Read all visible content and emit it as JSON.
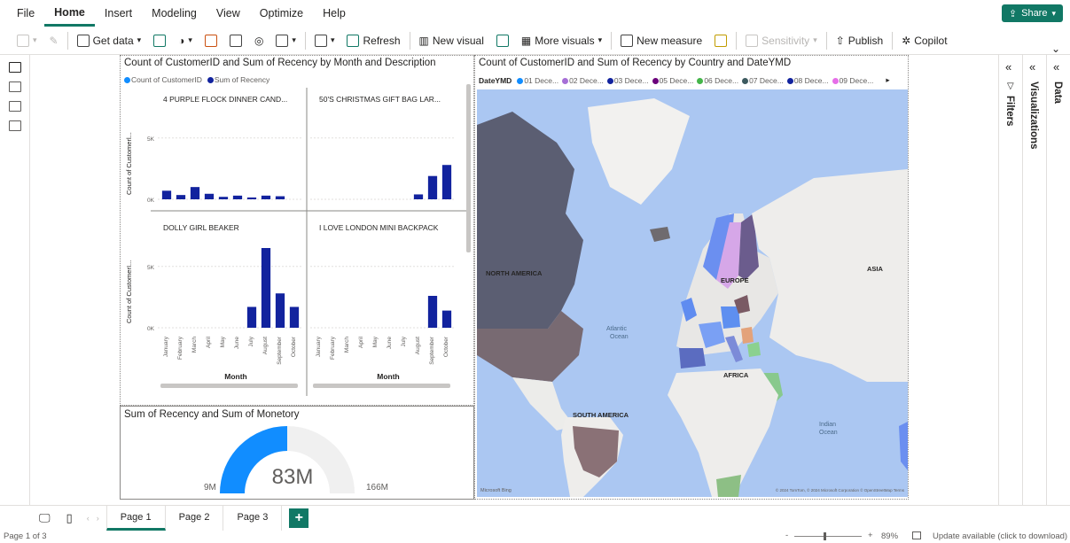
{
  "menu": {
    "items": [
      "File",
      "Home",
      "Insert",
      "Modeling",
      "View",
      "Optimize",
      "Help"
    ],
    "active": "Home",
    "share_label": "Share"
  },
  "ribbon": {
    "get_data": "Get data",
    "refresh": "Refresh",
    "new_visual": "New visual",
    "more_visuals": "More visuals",
    "new_measure": "New measure",
    "sensitivity": "Sensitivity",
    "publish": "Publish",
    "copilot": "Copilot"
  },
  "visual1": {
    "title": "Count of CustomerID and Sum of Recency by Month and Description",
    "legend": [
      {
        "label": "Count of CustomerID",
        "color": "#118DFF"
      },
      {
        "label": "Sum of Recency",
        "color": "#12239E"
      }
    ],
    "xlabel": "Month",
    "ylabel": "Count of CustomerI...",
    "ylabel_top": "Count of Customerl...",
    "tick_5k": "5K",
    "tick_0k": "0K"
  },
  "chart_data": [
    {
      "type": "bar",
      "title": "4 PURPLE FLOCK DINNER CAND...",
      "categories": [
        "January",
        "February",
        "March",
        "April",
        "May",
        "June",
        "July",
        "August",
        "September",
        "October"
      ],
      "series": [
        {
          "name": "Sum of Recency",
          "values": [
            700,
            350,
            1000,
            450,
            200,
            300,
            150,
            300,
            250,
            0
          ]
        }
      ],
      "ylim": [
        0,
        6500
      ]
    },
    {
      "type": "bar",
      "title": "50'S CHRISTMAS GIFT BAG LAR...",
      "categories": [
        "January",
        "February",
        "March",
        "April",
        "May",
        "June",
        "July",
        "August",
        "September",
        "October"
      ],
      "series": [
        {
          "name": "Sum of Recency",
          "values": [
            0,
            0,
            0,
            0,
            0,
            0,
            0,
            400,
            1900,
            2800
          ]
        }
      ],
      "ylim": [
        0,
        6500
      ]
    },
    {
      "type": "bar",
      "title": "DOLLY GIRL BEAKER",
      "categories": [
        "January",
        "February",
        "March",
        "April",
        "May",
        "June",
        "July",
        "August",
        "September",
        "October"
      ],
      "series": [
        {
          "name": "Sum of Recency",
          "values": [
            0,
            0,
            0,
            0,
            0,
            0,
            1700,
            6500,
            2800,
            1700
          ]
        }
      ],
      "ylim": [
        0,
        6500
      ]
    },
    {
      "type": "bar",
      "title": "I LOVE LONDON MINI BACKPACK",
      "categories": [
        "January",
        "February",
        "March",
        "April",
        "May",
        "June",
        "July",
        "August",
        "September",
        "October"
      ],
      "series": [
        {
          "name": "Sum of Recency",
          "values": [
            0,
            0,
            0,
            0,
            0,
            0,
            0,
            0,
            2600,
            1400
          ]
        }
      ],
      "ylim": [
        0,
        6500
      ]
    }
  ],
  "visual2": {
    "title": "Count of CustomerID and Sum of Recency by Country and DateYMD",
    "legend_title": "DateYMD",
    "legend": [
      {
        "label": "01 Dece...",
        "color": "#118DFF"
      },
      {
        "label": "02 Dece...",
        "color": "#A66FD6"
      },
      {
        "label": "03 Dece...",
        "color": "#12239E"
      },
      {
        "label": "05 Dece...",
        "color": "#6B007B"
      },
      {
        "label": "06 Dece...",
        "color": "#44B549"
      },
      {
        "label": "07 Dece...",
        "color": "#3D5A5F"
      },
      {
        "label": "08 Dece...",
        "color": "#12239E"
      },
      {
        "label": "09 Dece...",
        "color": "#E66EE8"
      }
    ],
    "labels": {
      "north_america": "NORTH AMERICA",
      "europe": "EUROPE",
      "asia": "ASIA",
      "africa": "AFRICA",
      "south_america": "SOUTH AMERICA",
      "atlantic": "Atlantic",
      "atlantic2": "Ocean",
      "indian": "Indian",
      "indian2": "Ocean"
    },
    "attribution": "© 2024 TomTom, © 2024 Microsoft Corporation  © OpenStreetMap  Terms",
    "bing": "Microsoft Bing"
  },
  "visual3": {
    "title": "Sum of Recency and Sum of Monetory",
    "value": "83M",
    "min": "9M",
    "max": "166M",
    "fraction": 0.5
  },
  "pages": {
    "tabs": [
      "Page 1",
      "Page 2",
      "Page 3"
    ],
    "active": "Page 1",
    "add": "+"
  },
  "panes": {
    "filters": "Filters",
    "visualizations": "Visualizations",
    "data": "Data"
  },
  "status": {
    "page_info": "Page 1 of 3",
    "zoom": "89%",
    "update": "Update available (click to download)"
  }
}
